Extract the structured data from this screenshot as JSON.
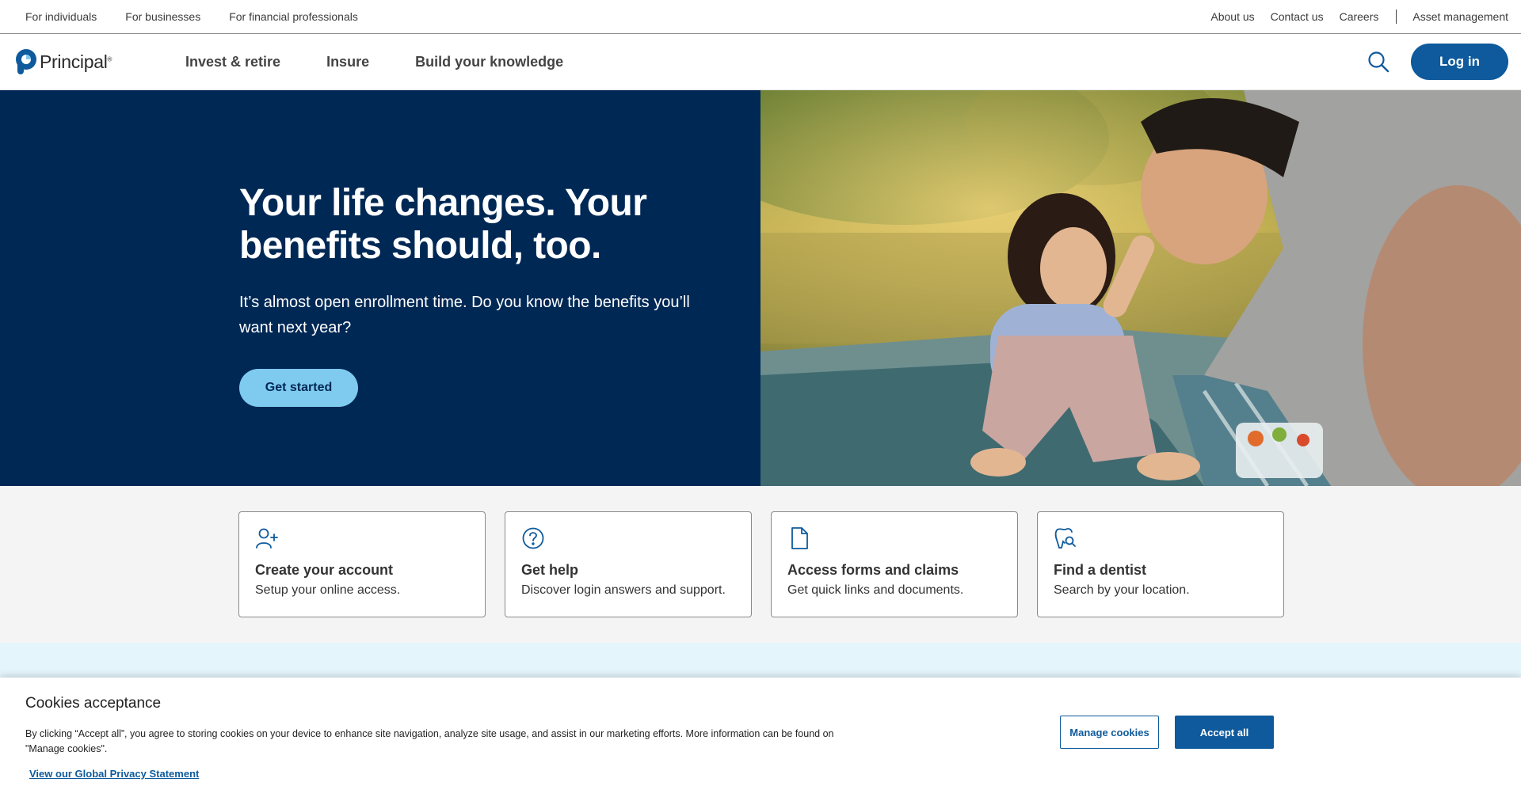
{
  "utility_nav": {
    "left": [
      "For individuals",
      "For businesses",
      "For financial professionals"
    ],
    "right": [
      "About us",
      "Contact us",
      "Careers",
      "Asset management"
    ]
  },
  "brand": {
    "name": "Principal",
    "mark": "®"
  },
  "main_nav": {
    "links": [
      "Invest & retire",
      "Insure",
      "Build your knowledge"
    ],
    "search_icon": "search-icon",
    "login_label": "Log in"
  },
  "hero": {
    "title": "Your life changes. Your benefits should, too.",
    "subtitle": "It’s almost open enrollment time. Do you know the benefits you’ll want next year?",
    "cta": "Get started"
  },
  "quick_links": [
    {
      "icon": "add-user-icon",
      "title": "Create your account",
      "desc": "Setup your online access."
    },
    {
      "icon": "question-circle-icon",
      "title": "Get help",
      "desc": "Discover login answers and support."
    },
    {
      "icon": "document-icon",
      "title": "Access forms and claims",
      "desc": "Get quick links and documents."
    },
    {
      "icon": "tooth-search-icon",
      "title": "Find a dentist",
      "desc": "Search by your location."
    }
  ],
  "cookie": {
    "title": "Cookies acceptance",
    "text": "By clicking “Accept all”, you agree to storing cookies on your device to enhance site navigation, analyze site usage, and assist in our marketing efforts. More information can be found on \"Manage cookies\".",
    "privacy_link": "View our Global Privacy Statement",
    "manage_label": "Manage cookies",
    "accept_label": "Accept all"
  },
  "colors": {
    "navy": "#002855",
    "brand_blue": "#0e5a9c",
    "light_blue": "#7fcbf0"
  }
}
